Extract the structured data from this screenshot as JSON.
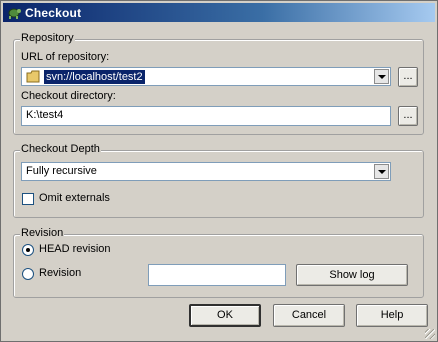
{
  "window": {
    "title": "Checkout",
    "icon": "turtle-app-icon"
  },
  "repository": {
    "group_label": "Repository",
    "url_label": "URL of repository:",
    "url_value": "svn://localhost/test2",
    "url_icon": "folder-icon",
    "browse_label": "...",
    "checkout_dir_label": "Checkout directory:",
    "checkout_dir_value": "K:\\test4",
    "browse_dir_label": "..."
  },
  "depth": {
    "group_label": "Checkout Depth",
    "selected": "Fully recursive",
    "omit_externals_label": "Omit externals",
    "omit_externals_checked": false
  },
  "revision": {
    "group_label": "Revision",
    "head_label": "HEAD revision",
    "head_selected": true,
    "revision_label": "Revision",
    "revision_value": "",
    "show_log_label": "Show log"
  },
  "buttons": {
    "ok": "OK",
    "cancel": "Cancel",
    "help": "Help"
  }
}
